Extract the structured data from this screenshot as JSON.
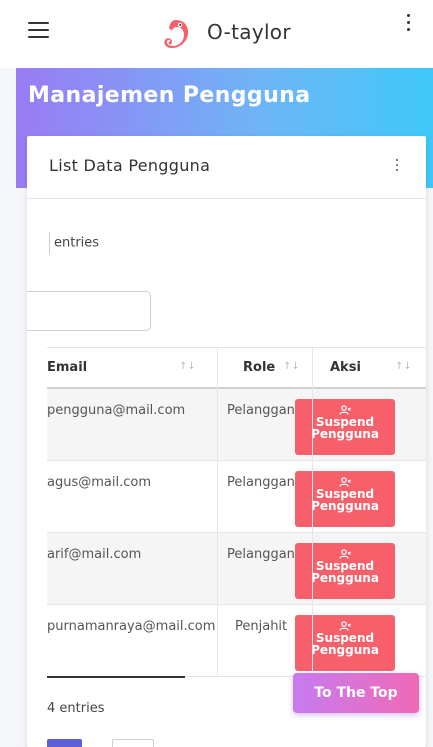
{
  "app": {
    "brand": "O-taylor",
    "brand_color": "#f7606b"
  },
  "header": {
    "menu_icon": "hamburger-icon",
    "more_icon": "vertical-dots-icon"
  },
  "banner": {
    "title": "Manajemen Pengguna"
  },
  "card": {
    "title": "List Data Pengguna",
    "more_icon": "vertical-dots-icon",
    "entries_top": "entries",
    "entries_bottom": "4 entries"
  },
  "table": {
    "headers": [
      {
        "label": "Email"
      },
      {
        "label": "Role"
      },
      {
        "label": "Aksi"
      }
    ],
    "rows": [
      {
        "email": "pengguna@mail.com",
        "role": "Pelanggan",
        "action": "Suspend Pengguna"
      },
      {
        "email": "agus@mail.com",
        "role": "Pelanggan",
        "action": "Suspend Pengguna"
      },
      {
        "email": "arif@mail.com",
        "role": "Pelanggan",
        "action": "Suspend Pengguna"
      },
      {
        "email": "purnamanraya@mail.com",
        "role": "Penjahit",
        "action": "Suspend Pengguna"
      }
    ]
  },
  "scroll_button": {
    "label": "To The Top"
  },
  "colors": {
    "accent": "#5c5fd6",
    "danger": "#f7606b"
  }
}
